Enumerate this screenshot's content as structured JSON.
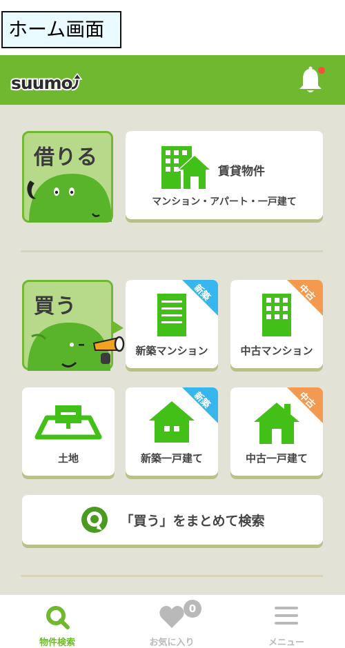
{
  "screen_caption": "ホーム画面",
  "header": {
    "logo_text": "suumo",
    "notification_has_unread": true
  },
  "rent": {
    "mascot_text": "借りる",
    "card": {
      "title": "賃貸物件",
      "subtitle": "マンション・アパート・一戸建て"
    }
  },
  "buy": {
    "mascot_text": "買う",
    "cards": [
      {
        "label": "新築マンション",
        "tag": "新築",
        "icon": "building-icon"
      },
      {
        "label": "中古マンション",
        "tag": "中古",
        "icon": "building-windows-icon"
      },
      {
        "label": "土地",
        "tag": "",
        "icon": "land-icon"
      },
      {
        "label": "新築一戸建て",
        "tag": "新築",
        "icon": "house-icon"
      },
      {
        "label": "中古一戸建て",
        "tag": "中古",
        "icon": "house-chimney-icon"
      }
    ],
    "search_all": "「買う」をまとめて検索"
  },
  "bottom_nav": {
    "items": [
      {
        "label": "物件検索",
        "icon": "search-icon",
        "active": true
      },
      {
        "label": "お気に入り",
        "icon": "heart-icon",
        "badge": "0"
      },
      {
        "label": "メニュー",
        "icon": "hamburger-menu-icon"
      }
    ]
  },
  "colors": {
    "brand_green": "#6fb82f",
    "icon_green": "#43c018",
    "background": "#e3e2d6",
    "new_tag": "#36b6ec",
    "used_tag": "#f39a50",
    "inactive_nav": "#b9b9b9"
  }
}
